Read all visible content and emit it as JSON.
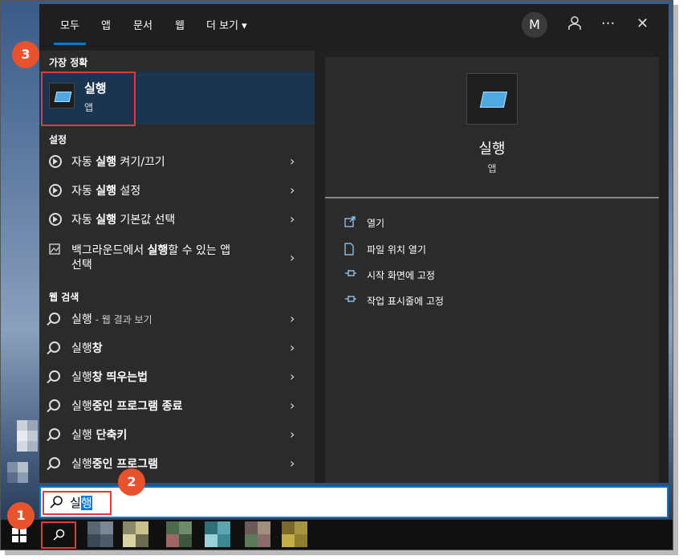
{
  "tabs": [
    "모두",
    "앱",
    "문서",
    "웹",
    "더 보기 ▾"
  ],
  "avatar_letter": "M",
  "icons": {
    "feedback": "feedback-icon",
    "more": "more-icon",
    "close": "close-icon"
  },
  "best_match": {
    "header": "가장 정확",
    "title": "실행",
    "subtitle": "앱"
  },
  "settings": {
    "header": "설정",
    "items": [
      {
        "prefix": "자동 ",
        "bold": "실행",
        "suffix": " 켜기/끄기"
      },
      {
        "prefix": "자동 ",
        "bold": "실행",
        "suffix": " 설정"
      },
      {
        "prefix": "자동 ",
        "bold": "실행",
        "suffix": " 기본값 선택"
      },
      {
        "prefix": "백그라운드에서 ",
        "bold": "실행",
        "suffix": "할 수 있는 앱",
        "line2": "선택"
      }
    ]
  },
  "web": {
    "header": "웹 검색",
    "items": [
      {
        "bold": "",
        "text": "실행",
        "sub": " - 웹 결과 보기"
      },
      {
        "bold": "창",
        "text": "실행",
        "sub": ""
      },
      {
        "bold": "창 띄우는법",
        "text": "실행",
        "sub": ""
      },
      {
        "bold": "중인 프로그램 종료",
        "text": "실행",
        "sub": ""
      },
      {
        "bold": " 단축키",
        "text": "실행",
        "sub": ""
      },
      {
        "bold": "중인 프로그램",
        "text": "실행",
        "sub": ""
      }
    ]
  },
  "preview": {
    "title": "실행",
    "subtitle": "앱",
    "actions": [
      "열기",
      "파일 위치 열기",
      "시작 화면에 고정",
      "작업 표시줄에 고정"
    ]
  },
  "search": {
    "typed": "실",
    "selected": "행"
  },
  "badges": [
    "1",
    "2",
    "3"
  ],
  "colors": {
    "accent": "#0078d4",
    "highlight_box": "#e03a3a",
    "badge": "#e8532d"
  }
}
